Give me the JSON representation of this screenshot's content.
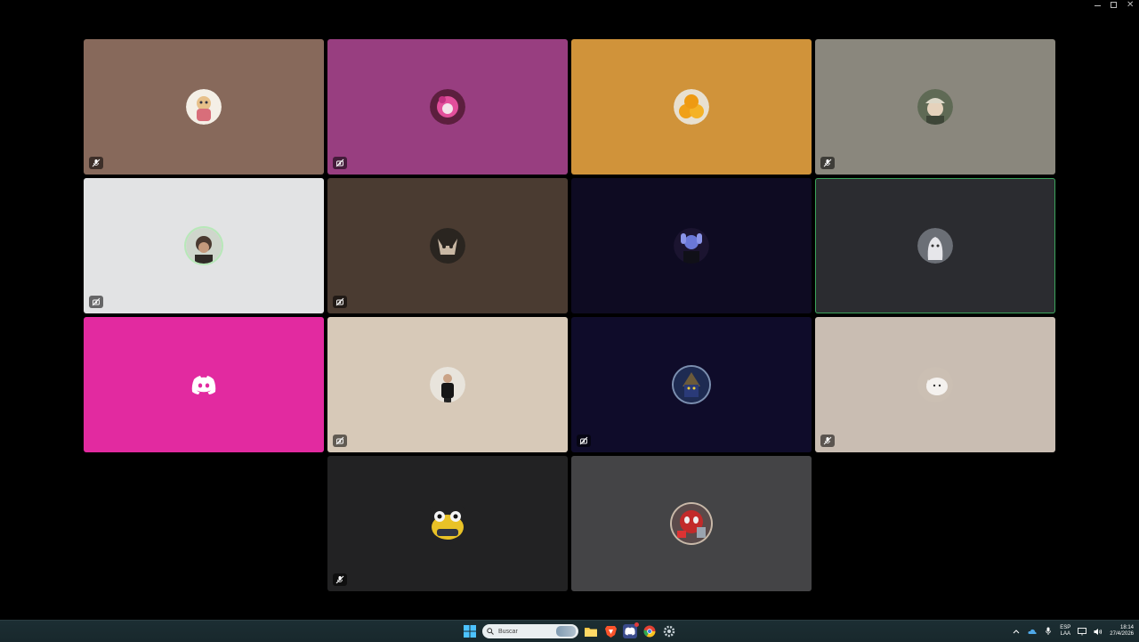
{
  "window": {
    "controls": [
      "minimize",
      "maximize",
      "close"
    ],
    "close_glyph": "✕"
  },
  "call": {
    "participants": [
      {
        "bg": "#87695b",
        "avatar": "anime-character-avatar",
        "badge": "mic-muted-icon"
      },
      {
        "bg": "#983e80",
        "avatar": "pink-character-avatar",
        "badge": "camera-off-icon"
      },
      {
        "bg": "#d0933a",
        "avatar": "oranges-avatar",
        "badge": null
      },
      {
        "bg": "#8a877d",
        "avatar": "man-with-cap-avatar",
        "badge": "mic-muted-icon"
      },
      {
        "bg": "#e2e3e4",
        "avatar": "person-photo-avatar",
        "badge": "camera-off-icon"
      },
      {
        "bg": "#4a3b31",
        "avatar": "cat-avatar",
        "badge": "camera-off-icon"
      },
      {
        "bg": "#0e0b22",
        "avatar": "blue-hands-avatar",
        "badge": null
      },
      {
        "bg": "#2b2c30",
        "avatar": "ghost-figure-avatar",
        "badge": null,
        "speaking": true
      },
      {
        "bg": "#e22aa0",
        "avatar": "discord-logo-avatar",
        "badge": null
      },
      {
        "bg": "#d7c9b8",
        "avatar": "man-in-black-avatar",
        "badge": "camera-off-icon"
      },
      {
        "bg": "#0f0c2a",
        "avatar": "black-mage-avatar",
        "badge": "camera-off-icon"
      },
      {
        "bg": "#c9bdb2",
        "avatar": "white-cat-avatar",
        "badge": "mic-muted-icon"
      },
      {
        "bg": "#222223",
        "avatar": "yellow-frog-avatar",
        "badge": "mic-muted-icon"
      },
      {
        "bg": "#444446",
        "avatar": "spiderman-avatar",
        "badge": null
      }
    ]
  },
  "taskbar": {
    "search_placeholder": "Buscar",
    "pinned": [
      "windows-start-icon",
      "search-box",
      "file-explorer-icon",
      "brave-browser-icon",
      "discord-icon",
      "chrome-icon",
      "settings-gear-icon"
    ],
    "language_top": "ESP",
    "language_bottom": "LAA",
    "time": "18:14",
    "date": "27/4/2026"
  }
}
